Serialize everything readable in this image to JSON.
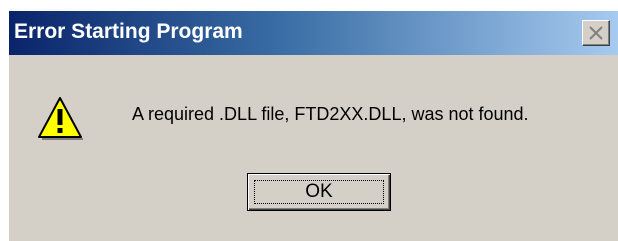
{
  "window": {
    "title": "Error Starting Program",
    "close_icon": "close-icon"
  },
  "content": {
    "icon": "warning-icon",
    "message": "A required .DLL file, FTD2XX.DLL, was not found."
  },
  "buttons": {
    "ok_label": "OK"
  },
  "colors": {
    "titlebar_start": "#0a246a",
    "titlebar_end": "#a6caf0",
    "dialog_bg": "#d4d0c8",
    "warning_fill": "#ffff00"
  }
}
